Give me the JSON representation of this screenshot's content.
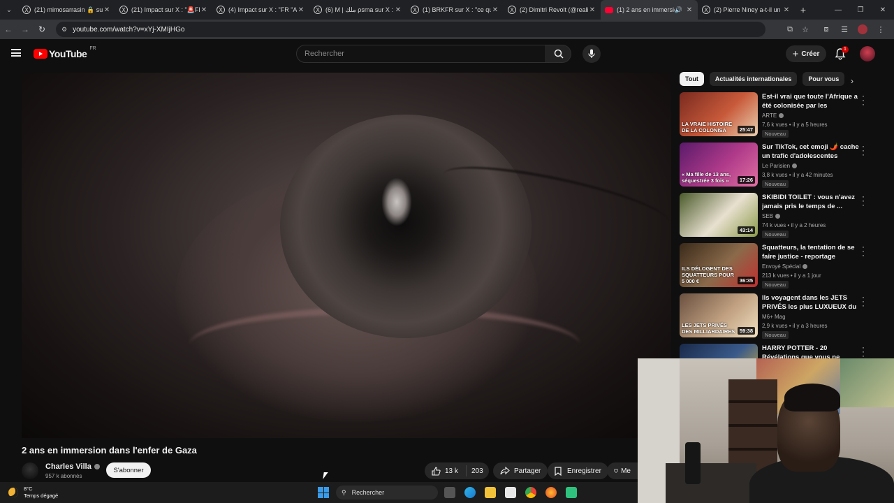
{
  "browser": {
    "tabs": [
      {
        "title": "(21) mimosarrasin 🔒 sur",
        "favicon": "X",
        "active": false
      },
      {
        "title": "(21) Impact sur X : \"🚨FR",
        "favicon": "X",
        "active": false
      },
      {
        "title": "(4) Impact sur X : \"FR \"Au",
        "favicon": "X",
        "active": false
      },
      {
        "title": "(6) M | ملك ρsma sur X : \"",
        "favicon": "X",
        "active": false
      },
      {
        "title": "(1) BRKFR sur X : \"ce que",
        "favicon": "X",
        "active": false
      },
      {
        "title": "(2) Dimitri Revolt (@realit",
        "favicon": "X",
        "active": false
      },
      {
        "title": "(1) 2 ans en immersio",
        "favicon": "youtube",
        "active": true,
        "audio": true
      },
      {
        "title": "(2) Pierre Niney a-t-il un",
        "favicon": "X",
        "active": false
      }
    ],
    "url": "youtube.com/watch?v=xYj-XMIjHGo"
  },
  "header": {
    "logo_text": "YouTube",
    "country_code": "FR",
    "search_placeholder": "Rechercher",
    "create_label": "Créer",
    "notification_count": "1"
  },
  "video": {
    "title": "2 ans en immersion dans l'enfer de Gaza",
    "channel": "Charles Villa",
    "subscribers": "957 k abonnés",
    "subscribe_label": "S'abonner",
    "likes": "13 k",
    "dislike_label": "203",
    "share_label": "Partager",
    "save_label": "Enregistrer",
    "more_label": "Me"
  },
  "sidebar": {
    "chips": [
      "Tout",
      "Actualités internationales",
      "Pour vous"
    ],
    "recommendations": [
      {
        "title": "Est-il vrai que toute l'Afrique a été colonisée par les Européen...",
        "channel": "ARTE",
        "verified": true,
        "meta": "7,6 k vues • il y a 5 heures",
        "badge": "Nouveau",
        "duration": "25:47",
        "thumb_text": "LA VRAIE HISTOIRE DE LA COLONISA",
        "thumb_colors": [
          "#7a2a20",
          "#c85a3a",
          "#e8d0b0"
        ]
      },
      {
        "title": "Sur TikTok, cet emoji 🌶️ cache un trafic d'adolescentes",
        "channel": "Le Parisien",
        "verified": true,
        "meta": "3,8 k vues • il y a 42 minutes",
        "badge": "Nouveau",
        "duration": "17:26",
        "thumb_text": "« Ma fille de 13 ans, séquestrée 3 fois »",
        "thumb_colors": [
          "#5a1a6a",
          "#b03a8a",
          "#e070a0"
        ]
      },
      {
        "title": "SKIBIDI TOILET : vous n'avez jamais pris le temps de ...",
        "channel": "SEB",
        "verified": true,
        "meta": "74 k vues • il y a 2 heures",
        "badge": "Nouveau",
        "duration": "43:14",
        "thumb_text": "",
        "thumb_colors": [
          "#4a5a2a",
          "#e8e0d0",
          "#8a9a4a"
        ]
      },
      {
        "title": "Squatteurs, la tentation de se faire justice - reportage intégral",
        "channel": "Envoyé Spécial",
        "verified": true,
        "meta": "213 k vues • il y a 1 jour",
        "badge": "Nouveau",
        "duration": "36:35",
        "thumb_text": "ILS DÉLOGENT DES SQUATTEURS POUR 5 000 €",
        "thumb_colors": [
          "#3a2a1a",
          "#8a6a4a",
          "#c03030"
        ]
      },
      {
        "title": "Ils voyagent dans les JETS PRIVÉS les plus LUXUEUX du ...",
        "channel": "M6+ Mag",
        "verified": false,
        "meta": "2,9 k vues • il y a 3 heures",
        "badge": "Nouveau",
        "duration": "59:38",
        "thumb_text": "LES JETS PRIVÉS DES MILLIARDAIRES",
        "thumb_colors": [
          "#6a5040",
          "#c0a080",
          "#f0e0c0"
        ]
      },
      {
        "title": "HARRY POTTER - 20 Révélations que vous ne",
        "channel": "",
        "verified": false,
        "meta": "",
        "badge": "",
        "duration": "",
        "thumb_text": "20 Révélations Que vous n'avez",
        "thumb_colors": [
          "#1a2a4a",
          "#3a5a8a",
          "#d0b040"
        ]
      }
    ]
  },
  "taskbar": {
    "temperature": "8°C",
    "weather_desc": "Temps dégagé",
    "search_label": "Rechercher"
  }
}
